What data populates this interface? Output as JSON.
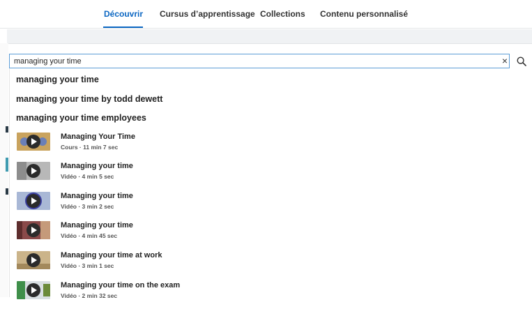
{
  "nav": {
    "tabs": [
      {
        "label": "Découvrir",
        "active": true
      },
      {
        "label": "Cursus d’apprentissage",
        "active": false
      },
      {
        "label": "Collections",
        "active": false
      },
      {
        "label": "Contenu personnalisé",
        "active": false
      }
    ]
  },
  "search": {
    "value": "managing your time",
    "clear_icon": "×",
    "search_icon": "search-icon"
  },
  "suggestions": [
    "managing your time",
    "managing your time by todd dewett",
    "managing your time employees"
  ],
  "results": [
    {
      "title": "Managing Your Time",
      "meta": "Cours · 11 min 7 sec"
    },
    {
      "title": "Managing your time",
      "meta": "Vidéo · 4 min 5 sec"
    },
    {
      "title": "Managing your time",
      "meta": "Vidéo · 3 min 2 sec"
    },
    {
      "title": "Managing your time",
      "meta": "Vidéo · 4 min 45 sec"
    },
    {
      "title": "Managing your time at work",
      "meta": "Vidéo · 3 min 1 sec"
    },
    {
      "title": "Managing your time on the exam",
      "meta": "Vidéo · 2 min 32 sec"
    }
  ],
  "colors": {
    "accent": "#0a66c2",
    "input_border": "#5a9bd5"
  }
}
